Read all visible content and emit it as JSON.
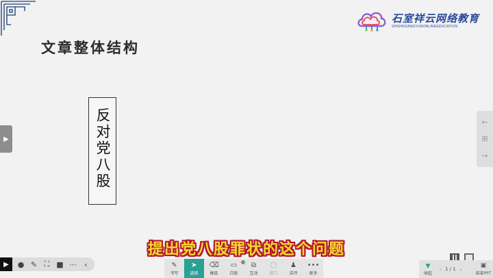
{
  "slide": {
    "title": "文章整体结构",
    "box_text": "反对党八股",
    "subtitle": "提出党八股罪状的这个问题"
  },
  "logo": {
    "name": "石室祥云网络教育",
    "tagline": "SHISHIXIANGYUNONLINEEDUCATION",
    "colors": [
      "#e9506a",
      "#f5a623",
      "#7cc04b",
      "#3a8ee6",
      "#8e5fd0"
    ]
  },
  "nav": {
    "left_arrow": "▶",
    "right_icons": [
      "←",
      "⊞",
      "→"
    ]
  },
  "bottom_left": {
    "icons": [
      "play-icon",
      "cursor-icon",
      "pen-icon",
      "screenshot-icon",
      "camera-icon",
      "more-icon",
      "collapse-icon"
    ]
  },
  "toolbar": {
    "tools": [
      {
        "label": "书写",
        "icon": "✎"
      },
      {
        "label": "选择",
        "icon": "➤"
      },
      {
        "label": "橡皮",
        "icon": "⌫"
      },
      {
        "label": "白板",
        "icon": "▭"
      },
      {
        "label": "互动",
        "icon": "⧉"
      },
      {
        "label": "窗口",
        "icon": "▢"
      },
      {
        "label": "讲评",
        "icon": "♟"
      },
      {
        "label": "更多",
        "icon": "•••"
      }
    ],
    "active": "选择"
  },
  "bottom_right": {
    "collapse_label": "收起",
    "page": "1 / 1",
    "end_label": "结束PPT"
  },
  "accent": "#2aa096"
}
